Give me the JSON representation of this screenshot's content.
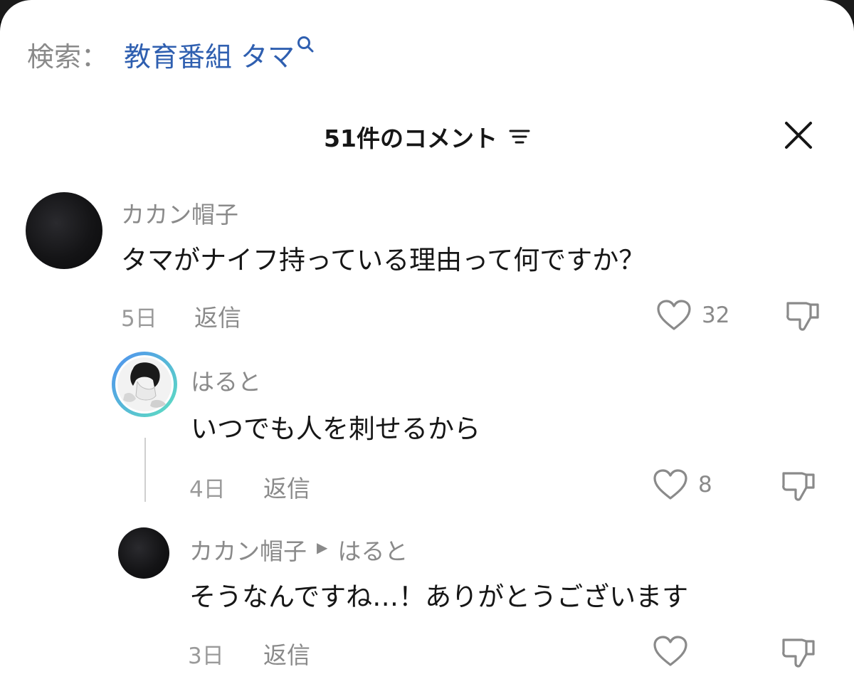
{
  "search": {
    "prefix": "検索：",
    "term": "教育番組 タマ"
  },
  "header": {
    "title": "51件のコメント"
  },
  "comments": [
    {
      "username": "カカン帽子",
      "text": "タマがナイフ持っている理由って何ですか？",
      "date": "5日",
      "reply_label": "返信",
      "likes": "32"
    },
    {
      "username": "はると",
      "text": "いつでも人を刺せるから",
      "date": "4日",
      "reply_label": "返信",
      "likes": "8"
    },
    {
      "username": "カカン帽子",
      "reply_to": "はると",
      "text": "そうなんですね…！ありがとうございます",
      "date": "3日",
      "reply_label": "返信",
      "likes": ""
    }
  ],
  "icons": {
    "search": "search-icon",
    "sort": "sort-icon",
    "close": "close-icon",
    "like": "heart-icon",
    "dislike": "thumbs-down-icon"
  },
  "colors": {
    "search_term": "#2f5fb0",
    "muted_text": "#8a8a8a",
    "primary_text": "#161616",
    "avatar_ring_start": "#4f8ff0",
    "avatar_ring_end": "#5ee0c0"
  }
}
